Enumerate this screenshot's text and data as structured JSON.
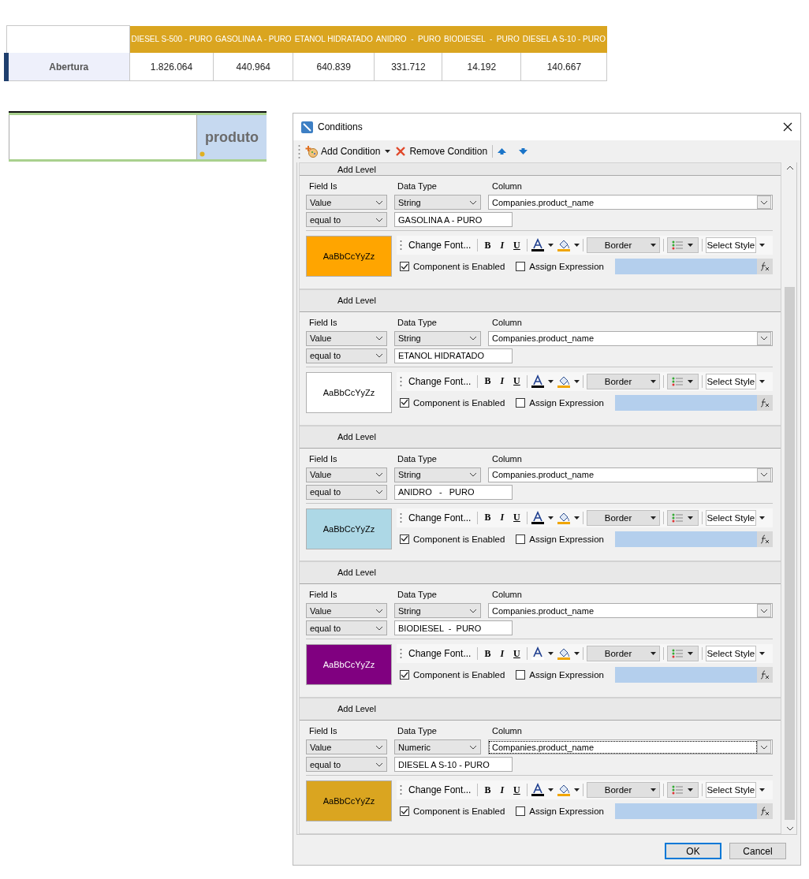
{
  "summary_table": {
    "columns": [
      "DIESEL S-500 - PURO",
      "GASOLINA A - PURO",
      "ETANOL HIDRATADO",
      "ANIDRO  -  PURO",
      "BIODIESEL  -  PURO",
      "DIESEL A S-10 - PURO"
    ],
    "rows": [
      {
        "label": "Abertura",
        "values": [
          "1.826.064",
          "440.964",
          "640.839",
          "331.712",
          "14.192",
          "140.667"
        ]
      }
    ]
  },
  "design_grid": {
    "cell": "produto"
  },
  "dialog": {
    "title": "Conditions",
    "toolbar": {
      "add": "Add Condition",
      "remove": "Remove Condition"
    },
    "conditions": [
      {
        "level_label": "Add Level",
        "field_is_label": "Field Is",
        "data_type_label": "Data Type",
        "column_label": "Column",
        "field_is": "Value",
        "data_type": "String",
        "column": "Companies.product_name",
        "column_focused": false,
        "operator": "equal to",
        "value": "GASOLINA A - PURO",
        "preview": "AaBbCcYyZz",
        "color": "#ffa500",
        "change_font": "Change Font...",
        "bold": "B",
        "italic": "I",
        "underline": "U",
        "border": "Border",
        "select_style": "Select Style",
        "component_enabled_label": "Component is Enabled",
        "component_enabled": true,
        "assign_expression_label": "Assign Expression",
        "assign_expression": false
      },
      {
        "level_label": "Add Level",
        "field_is_label": "Field Is",
        "data_type_label": "Data Type",
        "column_label": "Column",
        "field_is": "Value",
        "data_type": "String",
        "column": "Companies.product_name",
        "column_focused": false,
        "operator": "equal to",
        "value": "ETANOL HIDRATADO",
        "preview": "AaBbCcYyZz",
        "color": "#ffffff",
        "change_font": "Change Font...",
        "bold": "B",
        "italic": "I",
        "underline": "U",
        "border": "Border",
        "select_style": "Select Style",
        "component_enabled_label": "Component is Enabled",
        "component_enabled": true,
        "assign_expression_label": "Assign Expression",
        "assign_expression": false
      },
      {
        "level_label": "Add Level",
        "field_is_label": "Field Is",
        "data_type_label": "Data Type",
        "column_label": "Column",
        "field_is": "Value",
        "data_type": "String",
        "column": "Companies.product_name",
        "column_focused": false,
        "operator": "equal to",
        "value": "ANIDRO   -   PURO",
        "preview": "AaBbCcYyZz",
        "color": "#add8e6",
        "change_font": "Change Font...",
        "bold": "B",
        "italic": "I",
        "underline": "U",
        "border": "Border",
        "select_style": "Select Style",
        "component_enabled_label": "Component is Enabled",
        "component_enabled": true,
        "assign_expression_label": "Assign Expression",
        "assign_expression": false
      },
      {
        "level_label": "Add Level",
        "field_is_label": "Field Is",
        "data_type_label": "Data Type",
        "column_label": "Column",
        "field_is": "Value",
        "data_type": "String",
        "column": "Companies.product_name",
        "column_focused": false,
        "operator": "equal to",
        "value": "BIODIESEL  -  PURO",
        "preview": "AaBbCcYyZz",
        "color": "#800080",
        "change_font": "Change Font...",
        "bold": "B",
        "italic": "I",
        "underline": "U",
        "border": "Border",
        "select_style": "Select Style",
        "component_enabled_label": "Component is Enabled",
        "component_enabled": true,
        "assign_expression_label": "Assign Expression",
        "assign_expression": false
      },
      {
        "level_label": "Add Level",
        "field_is_label": "Field Is",
        "data_type_label": "Data Type",
        "column_label": "Column",
        "field_is": "Value",
        "data_type": "Numeric",
        "column": "Companies.product_name",
        "column_focused": true,
        "operator": "equal to",
        "value": "DIESEL A S-10 - PURO",
        "preview": "AaBbCcYyZz",
        "color": "#daa520",
        "change_font": "Change Font...",
        "bold": "B",
        "italic": "I",
        "underline": "U",
        "border": "Border",
        "select_style": "Select Style",
        "component_enabled_label": "Component is Enabled",
        "component_enabled": true,
        "assign_expression_label": "Assign Expression",
        "assign_expression": false
      }
    ],
    "buttons": [
      {
        "label": "OK",
        "default": true
      },
      {
        "label": "Cancel",
        "default": false
      }
    ]
  }
}
